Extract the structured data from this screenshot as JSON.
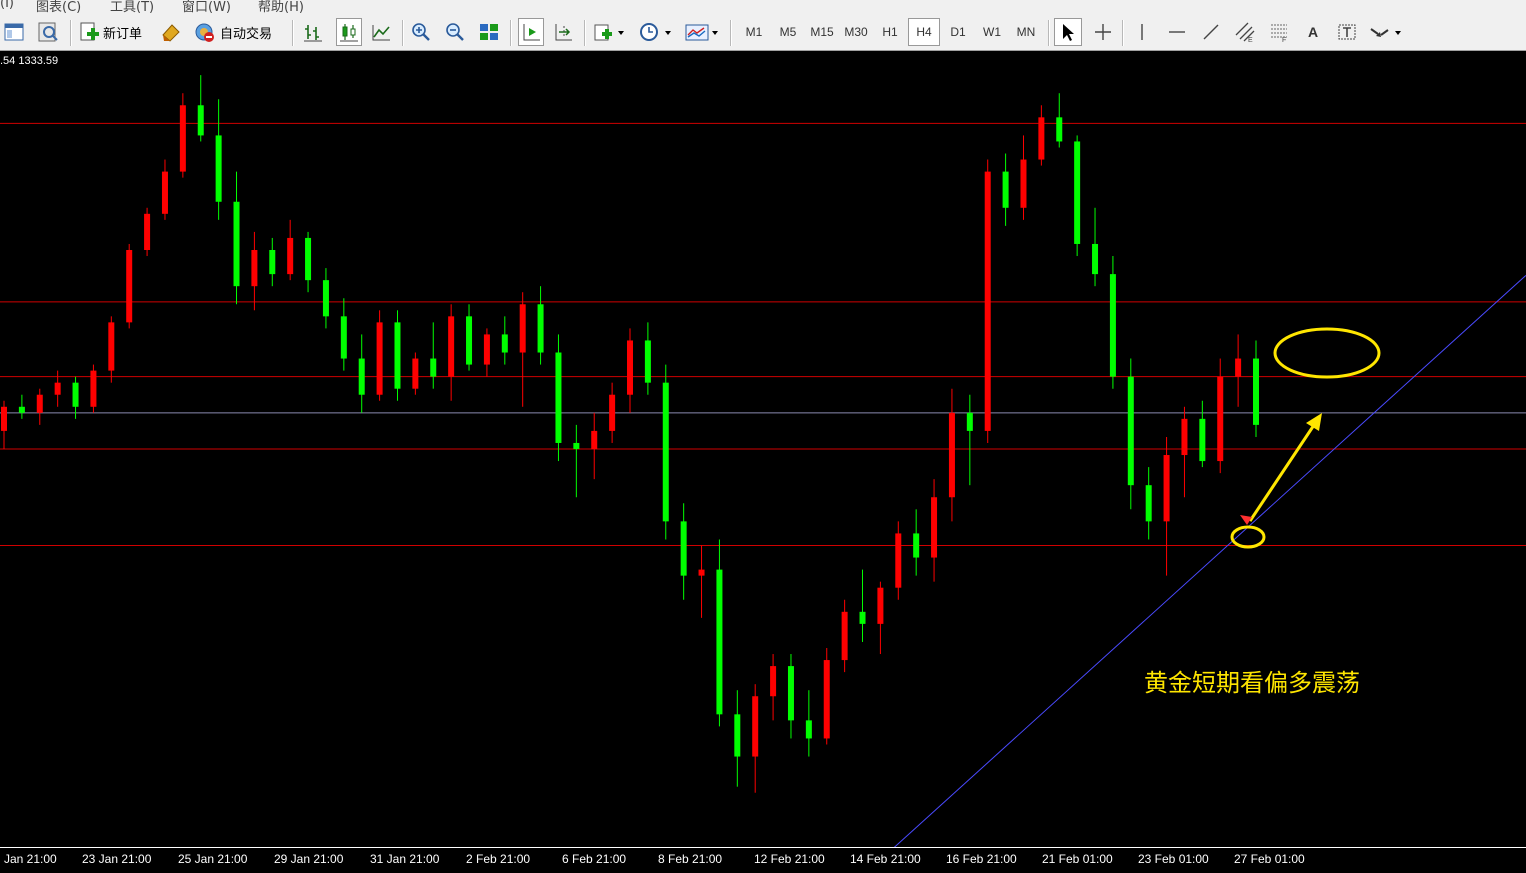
{
  "menubar": {
    "items": [
      "(I)",
      "图表(C)",
      "工具(T)",
      "窗口(W)",
      "帮助(H)"
    ]
  },
  "toolbar": {
    "new_order_label": "新订单",
    "auto_trade_label": "自动交易",
    "timeframes": [
      "M1",
      "M5",
      "M15",
      "M30",
      "H1",
      "H4",
      "D1",
      "W1",
      "MN"
    ],
    "active_timeframe": "H4",
    "text_tool_label": "A"
  },
  "chart": {
    "price_label": ".54 1333.59",
    "annotation": "黄金短期看偏多震荡",
    "x_labels": [
      "Jan 21:00",
      "23 Jan 21:00",
      "25 Jan 21:00",
      "29 Jan 21:00",
      "31 Jan 21:00",
      "2 Feb 21:00",
      "6 Feb 21:00",
      "8 Feb 21:00",
      "12 Feb 21:00",
      "14 Feb 21:00",
      "16 Feb 21:00",
      "21 Feb 01:00",
      "23 Feb 01:00",
      "27 Feb 01:00"
    ],
    "colors": {
      "up": "#ff0000",
      "down": "#00ff00",
      "level_line": "#d00000",
      "trend_line": "#4a4aff",
      "mid_line": "#8a8ab0",
      "annotation": "#ffe600",
      "background": "#000000"
    }
  },
  "chart_data": {
    "type": "candlestick",
    "instrument": "Gold",
    "timeframe": "H4",
    "ylim": [
      1300.0,
      1366.0
    ],
    "horizontal_levels": [
      1325.0,
      1333.0,
      1339.0,
      1345.2,
      1360.0
    ],
    "reference_level": 1336.0,
    "trendline": [
      [
        0.0,
        1299.2
      ],
      [
        1.0,
        1347.4
      ]
    ],
    "candles": [
      [
        1334.5,
        1337.0,
        1333.0,
        1336.5
      ],
      [
        1336.5,
        1337.5,
        1335.5,
        1336.0
      ],
      [
        1336.0,
        1338.0,
        1335.0,
        1337.5
      ],
      [
        1337.5,
        1339.5,
        1336.5,
        1338.5
      ],
      [
        1338.5,
        1339.0,
        1335.5,
        1336.5
      ],
      [
        1336.5,
        1340.0,
        1336.0,
        1339.5
      ],
      [
        1339.5,
        1344.0,
        1338.5,
        1343.5
      ],
      [
        1343.5,
        1350.0,
        1343.0,
        1349.5
      ],
      [
        1349.5,
        1353.0,
        1349.0,
        1352.5
      ],
      [
        1352.5,
        1357.0,
        1352.0,
        1356.0
      ],
      [
        1356.0,
        1362.5,
        1355.5,
        1361.5
      ],
      [
        1361.5,
        1364.0,
        1358.5,
        1359.0
      ],
      [
        1359.0,
        1362.0,
        1352.0,
        1353.5
      ],
      [
        1353.5,
        1356.0,
        1345.0,
        1346.5
      ],
      [
        1346.5,
        1351.0,
        1344.5,
        1349.5
      ],
      [
        1349.5,
        1350.5,
        1346.5,
        1347.5
      ],
      [
        1347.5,
        1352.0,
        1347.0,
        1350.5
      ],
      [
        1350.5,
        1351.0,
        1346.0,
        1347.0
      ],
      [
        1347.0,
        1348.0,
        1343.0,
        1344.0
      ],
      [
        1344.0,
        1345.5,
        1339.5,
        1340.5
      ],
      [
        1340.5,
        1342.5,
        1336.0,
        1337.5
      ],
      [
        1337.5,
        1344.5,
        1337.0,
        1343.5
      ],
      [
        1343.5,
        1344.5,
        1337.0,
        1338.0
      ],
      [
        1338.0,
        1341.0,
        1337.5,
        1340.5
      ],
      [
        1340.5,
        1343.5,
        1338.0,
        1339.0
      ],
      [
        1339.0,
        1345.0,
        1337.0,
        1344.0
      ],
      [
        1344.0,
        1345.0,
        1339.5,
        1340.0
      ],
      [
        1340.0,
        1343.0,
        1339.0,
        1342.5
      ],
      [
        1342.5,
        1344.0,
        1340.0,
        1341.0
      ],
      [
        1341.0,
        1346.0,
        1336.5,
        1345.0
      ],
      [
        1345.0,
        1346.5,
        1340.0,
        1341.0
      ],
      [
        1341.0,
        1342.5,
        1332.0,
        1333.5
      ],
      [
        1333.5,
        1335.0,
        1329.0,
        1333.0
      ],
      [
        1333.0,
        1336.0,
        1330.5,
        1334.5
      ],
      [
        1334.5,
        1338.5,
        1333.5,
        1337.5
      ],
      [
        1337.5,
        1343.0,
        1336.0,
        1342.0
      ],
      [
        1342.0,
        1343.5,
        1337.5,
        1338.5
      ],
      [
        1338.5,
        1340.0,
        1325.5,
        1327.0
      ],
      [
        1327.0,
        1328.5,
        1320.5,
        1322.5
      ],
      [
        1322.5,
        1325.0,
        1319.0,
        1323.0
      ],
      [
        1323.0,
        1325.5,
        1310.0,
        1311.0
      ],
      [
        1311.0,
        1313.0,
        1305.0,
        1307.5
      ],
      [
        1307.5,
        1313.5,
        1304.5,
        1312.5
      ],
      [
        1312.5,
        1316.0,
        1310.5,
        1315.0
      ],
      [
        1315.0,
        1316.0,
        1309.0,
        1310.5
      ],
      [
        1310.5,
        1313.0,
        1307.5,
        1309.0
      ],
      [
        1309.0,
        1316.5,
        1308.5,
        1315.5
      ],
      [
        1315.5,
        1320.5,
        1314.5,
        1319.5
      ],
      [
        1319.5,
        1323.0,
        1317.0,
        1318.5
      ],
      [
        1318.5,
        1322.0,
        1316.0,
        1321.5
      ],
      [
        1321.5,
        1327.0,
        1320.5,
        1326.0
      ],
      [
        1326.0,
        1328.0,
        1322.5,
        1324.0
      ],
      [
        1324.0,
        1330.5,
        1322.0,
        1329.0
      ],
      [
        1329.0,
        1338.0,
        1327.0,
        1336.0
      ],
      [
        1336.0,
        1337.5,
        1330.0,
        1334.5
      ],
      [
        1334.5,
        1357.0,
        1333.5,
        1356.0
      ],
      [
        1356.0,
        1357.5,
        1351.5,
        1353.0
      ],
      [
        1353.0,
        1359.0,
        1352.0,
        1357.0
      ],
      [
        1357.0,
        1361.5,
        1356.5,
        1360.5
      ],
      [
        1360.5,
        1362.5,
        1358.0,
        1358.5
      ],
      [
        1358.5,
        1359.0,
        1349.0,
        1350.0
      ],
      [
        1350.0,
        1353.0,
        1346.5,
        1347.5
      ],
      [
        1347.5,
        1349.0,
        1338.0,
        1339.0
      ],
      [
        1339.0,
        1340.5,
        1328.0,
        1330.0
      ],
      [
        1330.0,
        1331.5,
        1325.5,
        1327.0
      ],
      [
        1327.0,
        1334.0,
        1322.5,
        1332.5
      ],
      [
        1332.5,
        1336.5,
        1329.0,
        1335.5
      ],
      [
        1335.5,
        1337.0,
        1331.5,
        1332.0
      ],
      [
        1332.0,
        1340.5,
        1331.0,
        1339.0
      ],
      [
        1339.0,
        1342.5,
        1336.5,
        1340.5
      ],
      [
        1340.5,
        1342.0,
        1334.0,
        1335.0
      ]
    ]
  }
}
